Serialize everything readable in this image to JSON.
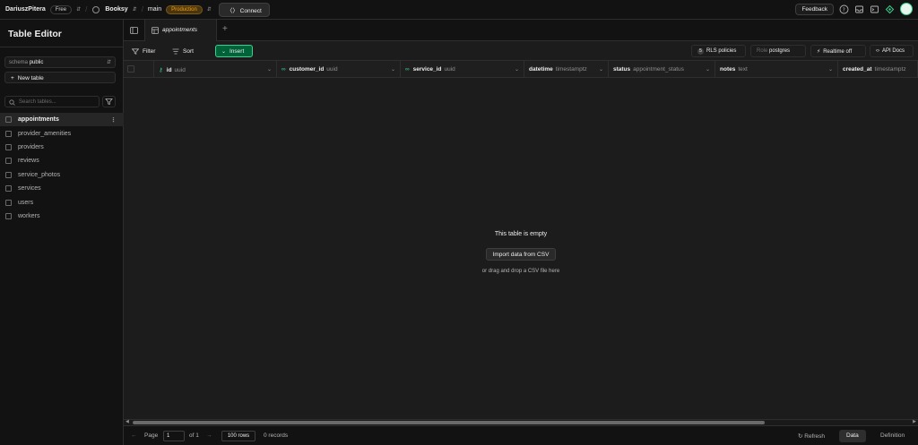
{
  "topbar": {
    "org": "DariuszPitera",
    "plan": "Free",
    "project": "Booksy",
    "branch": "main",
    "env": "Production",
    "connect": "Connect",
    "feedback": "Feedback"
  },
  "sidebar": {
    "title": "Table Editor",
    "schema_label": "schema",
    "schema_value": "public",
    "new_table": "New table",
    "search_placeholder": "Search tables...",
    "tables": [
      "appointments",
      "provider_amenities",
      "providers",
      "reviews",
      "service_photos",
      "services",
      "users",
      "workers"
    ],
    "active_index": 0
  },
  "tabs": {
    "active": "appointments",
    "add": "+"
  },
  "toolbar": {
    "filter": "Filter",
    "sort": "Sort",
    "insert": "Insert",
    "rls": "RLS policies",
    "role_label": "Role",
    "role_value": "postgres",
    "realtime": "Realtime off",
    "api_docs": "API Docs"
  },
  "columns": [
    {
      "name": "id",
      "type": "uuid"
    },
    {
      "name": "customer_id",
      "type": "uuid"
    },
    {
      "name": "service_id",
      "type": "uuid"
    },
    {
      "name": "datetime",
      "type": "timestamptz"
    },
    {
      "name": "status",
      "type": "appointment_status"
    },
    {
      "name": "notes",
      "type": "text"
    },
    {
      "name": "created_at",
      "type": "timestamptz"
    }
  ],
  "empty": {
    "title": "This table is empty",
    "import": "Import data from CSV",
    "drag": "or drag and drop a CSV file here"
  },
  "footer": {
    "page_label": "Page",
    "page": "1",
    "of": "of 1",
    "rows": "100 rows",
    "records": "0 records",
    "refresh": "Refresh",
    "data": "Data",
    "definition": "Definition"
  },
  "colors": {
    "accent": "#3ecf8e",
    "insert_bg": "#006239",
    "production": "#f1a10d"
  }
}
